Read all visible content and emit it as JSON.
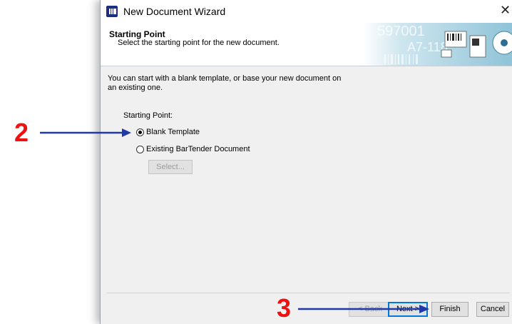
{
  "window": {
    "title": "New Document Wizard"
  },
  "header": {
    "title": "Starting Point",
    "subtitle": "Select the starting point for the new document.",
    "banner_text_1": "597001",
    "banner_text_2": "A7-118"
  },
  "body": {
    "intro": "You can start with a blank template, or base your new document on an existing one.",
    "starting_point_label": "Starting Point:",
    "options": [
      {
        "label": "Blank Template",
        "selected": true
      },
      {
        "label": "Existing BarTender Document",
        "selected": false
      }
    ],
    "select_button": "Select..."
  },
  "footer": {
    "back": "< Back",
    "next": "Next >",
    "finish": "Finish",
    "cancel": "Cancel"
  },
  "annotations": {
    "step2": "2",
    "step3": "3"
  },
  "colors": {
    "annotation_number": "#ee1111",
    "annotation_arrow": "#1f3aa8",
    "focus": "#0078d7"
  }
}
